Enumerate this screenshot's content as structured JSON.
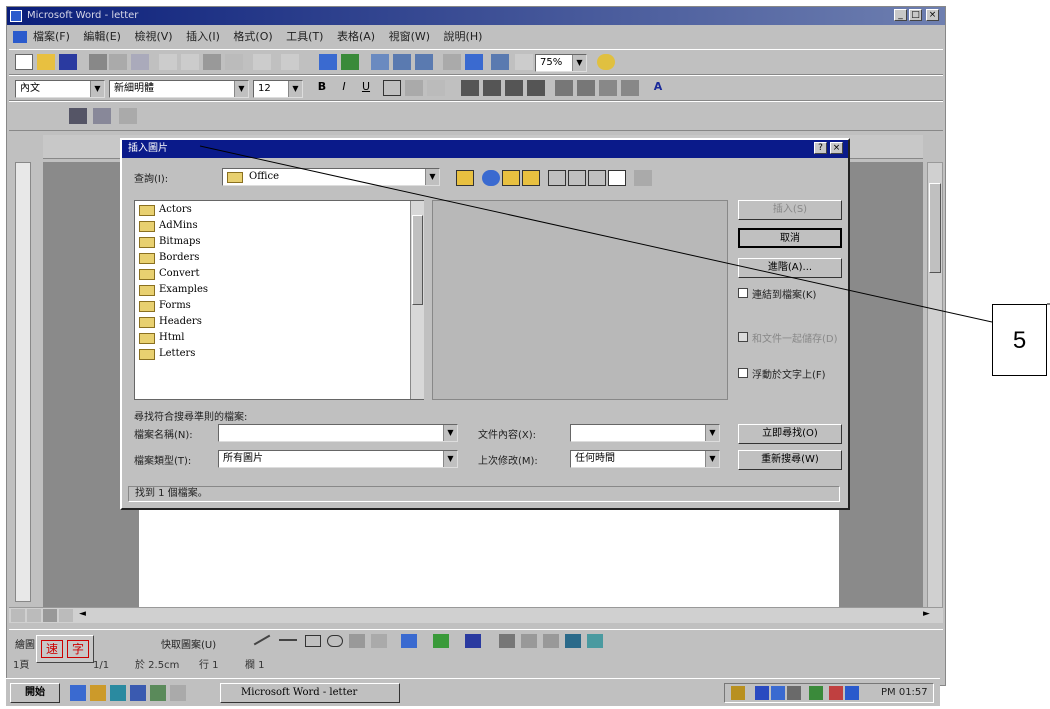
{
  "window": {
    "title": "Microsoft Word - letter",
    "controls": [
      "_",
      "□",
      "×"
    ]
  },
  "menubar": {
    "items": [
      "檔案(F)",
      "編輯(E)",
      "檢視(V)",
      "插入(I)",
      "格式(O)",
      "工具(T)",
      "表格(A)",
      "視窗(W)",
      "說明(H)"
    ]
  },
  "formatting": {
    "style": "內文",
    "font": "新細明體",
    "size": "12",
    "zoom": "75%"
  },
  "dialog": {
    "title": "插入圖片",
    "lookin_label": "查詢(I):",
    "lookin_value": "Office",
    "files": [
      "Actors",
      "AdMins",
      "Bitmaps",
      "Borders",
      "Convert",
      "Examples",
      "Forms",
      "Headers",
      "Html",
      "Letters"
    ],
    "insert_button": "插入(S)",
    "cancel_button": "取消",
    "advanced_button": "進階(A)...",
    "link_checkbox": "連結到檔案(K)",
    "save_with_doc_checkbox": "和文件一起儲存(D)",
    "float_checkbox": "浮動於文字上(F)",
    "criteria_label": "尋找符合搜尋準則的檔案:",
    "filename_label": "檔案名稱(N):",
    "filename_value": "",
    "filetype_label": "檔案類型(T):",
    "filetype_value": "所有圖片",
    "textprop_label": "文件內容(X):",
    "textprop_value": "",
    "modified_label": "上次修改(M):",
    "modified_value": "任何時間",
    "findnow_button": "立即尋找(O)",
    "newsearch_button": "重新搜尋(W)",
    "found_status": "找到 1 個檔案。"
  },
  "statusbar": {
    "page": "1頁",
    "section": "1/1",
    "position": "於 2.5cm",
    "line": "行 1",
    "column": "欄 1"
  },
  "taskbar": {
    "start": "開始",
    "task": "Microsoft Word - letter",
    "clock": "PM 01:57"
  },
  "ime": {
    "label1": "速",
    "label2": "字"
  },
  "drawbar": {
    "draw_label": "繪圖",
    "autoshapes_label": "快取圖案(U)"
  },
  "callout": {
    "number": "5"
  }
}
